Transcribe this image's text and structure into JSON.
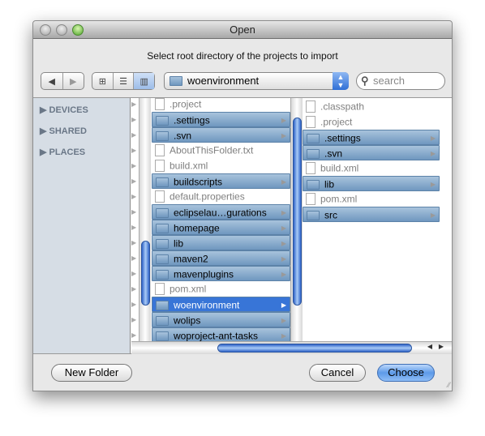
{
  "window": {
    "title": "Open",
    "prompt": "Select root directory of the projects to import"
  },
  "toolbar": {
    "back": "◀",
    "forward": "▶",
    "view_icons": "icon-view",
    "view_list": "list-view",
    "view_columns": "column-view",
    "location": "woenvironment",
    "search_placeholder": "search"
  },
  "sidebar": {
    "sections": [
      {
        "label": "DEVICES"
      },
      {
        "label": "SHARED"
      },
      {
        "label": "PLACES"
      }
    ]
  },
  "column2": {
    "items": [
      {
        "name": ".project",
        "type": "file"
      },
      {
        "name": ".settings",
        "type": "folder"
      },
      {
        "name": ".svn",
        "type": "folder"
      },
      {
        "name": "AboutThisFolder.txt",
        "type": "file"
      },
      {
        "name": "build.xml",
        "type": "file"
      },
      {
        "name": "buildscripts",
        "type": "folder"
      },
      {
        "name": "default.properties",
        "type": "file"
      },
      {
        "name": "eclipselau…gurations",
        "type": "folder"
      },
      {
        "name": "homepage",
        "type": "folder"
      },
      {
        "name": "lib",
        "type": "folder"
      },
      {
        "name": "maven2",
        "type": "folder"
      },
      {
        "name": "mavenplugins",
        "type": "folder"
      },
      {
        "name": "pom.xml",
        "type": "file"
      },
      {
        "name": "woenvironment",
        "type": "folder",
        "selected": true
      },
      {
        "name": "wolips",
        "type": "folder"
      },
      {
        "name": "woproject-ant-tasks",
        "type": "folder"
      }
    ]
  },
  "column3": {
    "items": [
      {
        "name": ".classpath",
        "type": "file"
      },
      {
        "name": ".project",
        "type": "file"
      },
      {
        "name": ".settings",
        "type": "folder"
      },
      {
        "name": ".svn",
        "type": "folder"
      },
      {
        "name": "build.xml",
        "type": "file"
      },
      {
        "name": "lib",
        "type": "folder"
      },
      {
        "name": "pom.xml",
        "type": "file"
      },
      {
        "name": "src",
        "type": "folder"
      }
    ]
  },
  "buttons": {
    "new_folder": "New Folder",
    "cancel": "Cancel",
    "choose": "Choose"
  },
  "colors": {
    "selection": "#3875d7",
    "sidebar": "#d6dde5"
  }
}
